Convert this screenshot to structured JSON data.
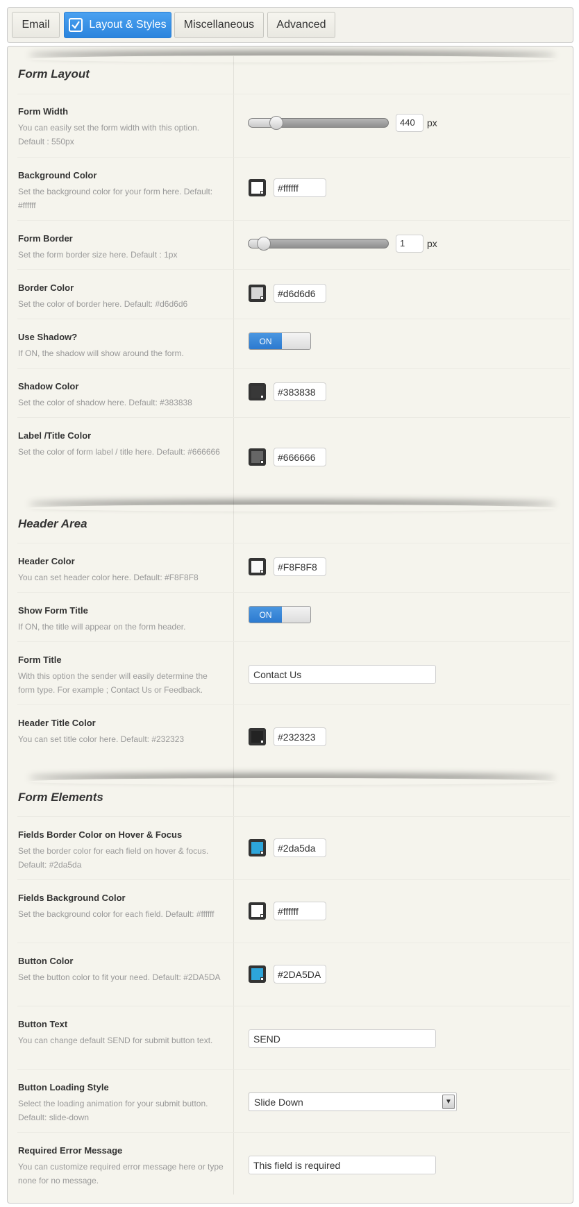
{
  "tabs": [
    {
      "label": "Email"
    },
    {
      "label": "Layout & Styles"
    },
    {
      "label": "Miscellaneous"
    },
    {
      "label": "Advanced"
    }
  ],
  "active_tab": "Layout & Styles",
  "sections": {
    "form_layout": {
      "title": "Form Layout",
      "form_width": {
        "label": "Form Width",
        "desc": "You can easily set the form width with this option. Default : 550px",
        "value": "440",
        "unit": "px",
        "slider_fraction": 0.2
      },
      "background_color": {
        "label": "Background Color",
        "desc": "Set the background color for your form here. Default: #ffffff",
        "value": "#ffffff",
        "swatch": "#ffffff"
      },
      "form_border": {
        "label": "Form Border",
        "desc": "Set the form border size here. Default : 1px",
        "value": "1",
        "unit": "px",
        "slider_fraction": 0.1
      },
      "border_color": {
        "label": "Border Color",
        "desc": "Set the color of border here. Default: #d6d6d6",
        "value": "#d6d6d6",
        "swatch": "#d6d6d6"
      },
      "use_shadow": {
        "label": "Use Shadow?",
        "desc": "If ON, the shadow will show around the form.",
        "state": "ON"
      },
      "shadow_color": {
        "label": "Shadow Color",
        "desc": "Set the color of shadow here. Default: #383838",
        "value": "#383838",
        "swatch": "#383838"
      },
      "label_color": {
        "label": "Label /Title Color",
        "desc": "Set the color of form label / title here. Default: #666666",
        "value": "#666666",
        "swatch": "#666666"
      }
    },
    "header_area": {
      "title": "Header Area",
      "header_color": {
        "label": "Header Color",
        "desc": "You can set header color here. Default: #F8F8F8",
        "value": "#F8F8F8",
        "swatch": "#F8F8F8"
      },
      "show_form_title": {
        "label": "Show Form Title",
        "desc": "If ON, the title will appear on the form header.",
        "state": "ON"
      },
      "form_title": {
        "label": "Form Title",
        "desc": "With this option the sender will easily determine the form type. For example ; Contact Us or Feedback.",
        "value": "Contact Us"
      },
      "header_title_color": {
        "label": "Header Title Color",
        "desc": "You can set title color here. Default: #232323",
        "value": "#232323",
        "swatch": "#232323"
      }
    },
    "form_elements": {
      "title": "Form Elements",
      "fields_border_color": {
        "label": "Fields Border Color on Hover & Focus",
        "desc": "Set the border color for each field on hover & focus. Default: #2da5da",
        "value": "#2da5da",
        "swatch": "#2da5da"
      },
      "fields_bg_color": {
        "label": "Fields Background Color",
        "desc": "Set the background color for each field. Default: #ffffff",
        "value": "#ffffff",
        "swatch": "#ffffff"
      },
      "button_color": {
        "label": "Button Color",
        "desc": "Set the button color to fit your need. Default: #2DA5DA",
        "value": "#2DA5DA",
        "swatch": "#2DA5DA"
      },
      "button_text": {
        "label": "Button Text",
        "desc": "You can change default SEND for submit button text.",
        "value": "SEND"
      },
      "button_loading_style": {
        "label": "Button Loading Style",
        "desc": "Select the loading animation for your submit button. Default: slide-down",
        "value": "Slide Down"
      },
      "required_error": {
        "label": "Required Error Message",
        "desc": "You can customize required error message here or type none for no message.",
        "value": "This field is required"
      }
    }
  }
}
